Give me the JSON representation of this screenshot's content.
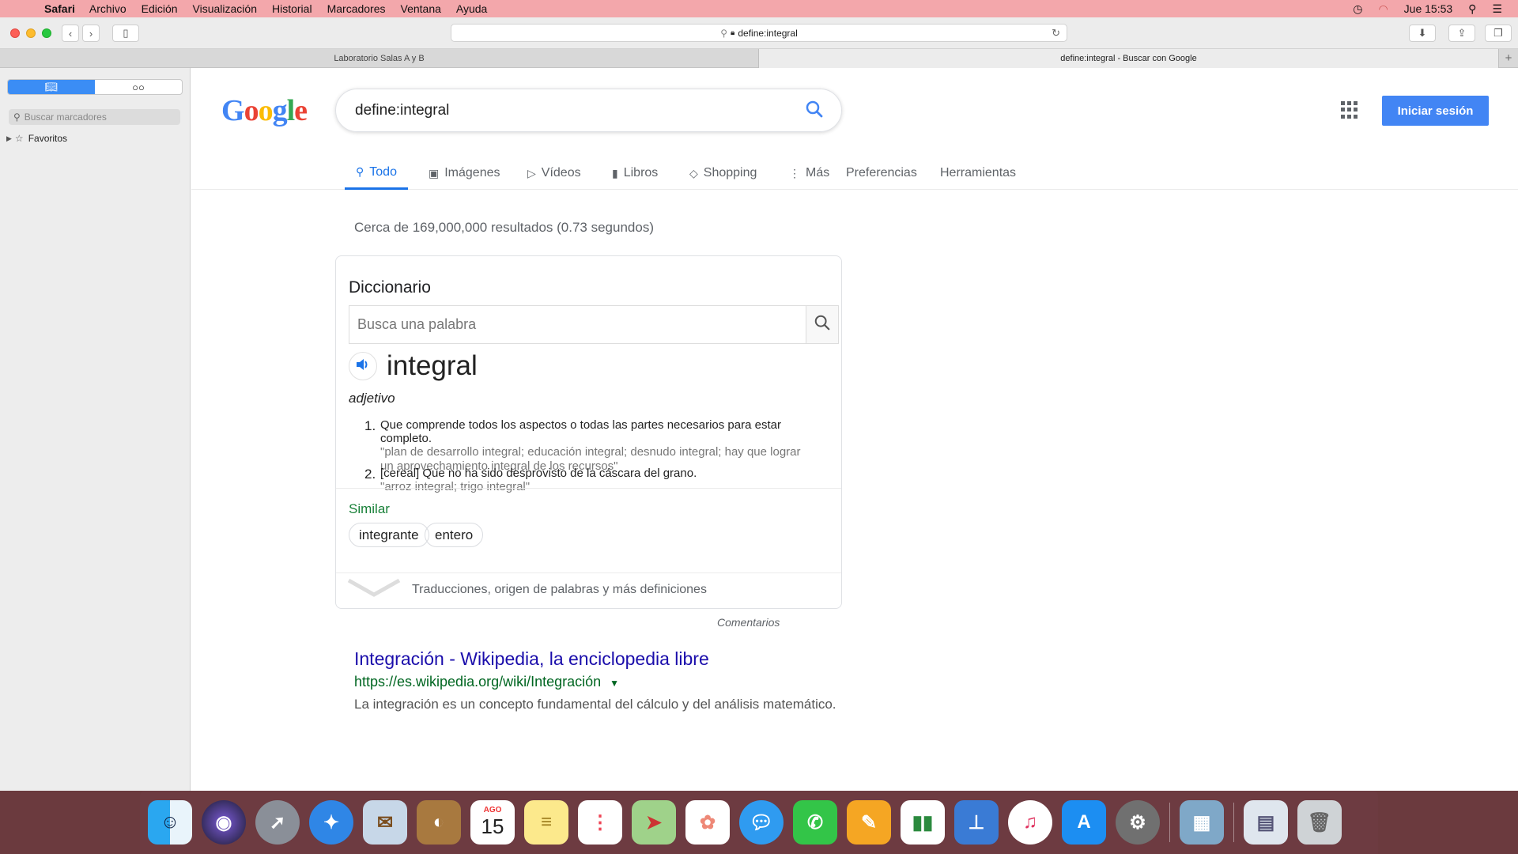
{
  "menubar": {
    "items": [
      "Safari",
      "Archivo",
      "Edición",
      "Visualización",
      "Historial",
      "Marcadores",
      "Ventana",
      "Ayuda"
    ],
    "clock": "Jue 15:53"
  },
  "browser": {
    "url": "define:integral",
    "tabs": [
      "Laboratorio Salas A y B",
      "define:integral - Buscar con Google"
    ],
    "active_tab": 1
  },
  "sidebar": {
    "search_placeholder": "Buscar marcadores",
    "favorites_label": "Favoritos"
  },
  "google": {
    "query": "define:integral",
    "signin": "Iniciar sesión",
    "tabs": [
      "Todo",
      "Imágenes",
      "Vídeos",
      "Libros",
      "Shopping",
      "Más",
      "Preferencias",
      "Herramientas"
    ],
    "stats": "Cerca de 169,000,000 resultados (0.73 segundos)"
  },
  "dictionary": {
    "title": "Diccionario",
    "placeholder": "Busca una palabra",
    "word": "integral",
    "pos": "adjetivo",
    "definitions": [
      {
        "num": "1.",
        "text": "Que comprende todos los aspectos o todas las partes necesarios para estar completo.",
        "example": "\"plan de desarrollo integral; educación integral; desnudo integral; hay que lograr un aprovechamiento integral de los recursos\""
      },
      {
        "num": "2.",
        "text": "[cereal] Que no ha sido desprovisto de la cáscara del grano.",
        "example": "\"arroz integral; trigo integral\""
      }
    ],
    "similar_label": "Similar",
    "similar": [
      "integrante",
      "entero"
    ],
    "more": "Traducciones, origen de palabras y más definiciones",
    "feedback": "Comentarios"
  },
  "result": {
    "title": "Integración - Wikipedia, la enciclopedia libre",
    "url": "https://es.wikipedia.org/wiki/Integración",
    "snippet": "La integración es un concepto fundamental del cálculo y del análisis matemático."
  },
  "dock": {
    "calendar_month": "AGO",
    "calendar_day": "15"
  },
  "colors": {
    "menubar": "#f3a7ab",
    "google_blue": "#4285f4",
    "link": "#1a0dab",
    "url_green": "#006621",
    "similar_green": "#188038"
  }
}
